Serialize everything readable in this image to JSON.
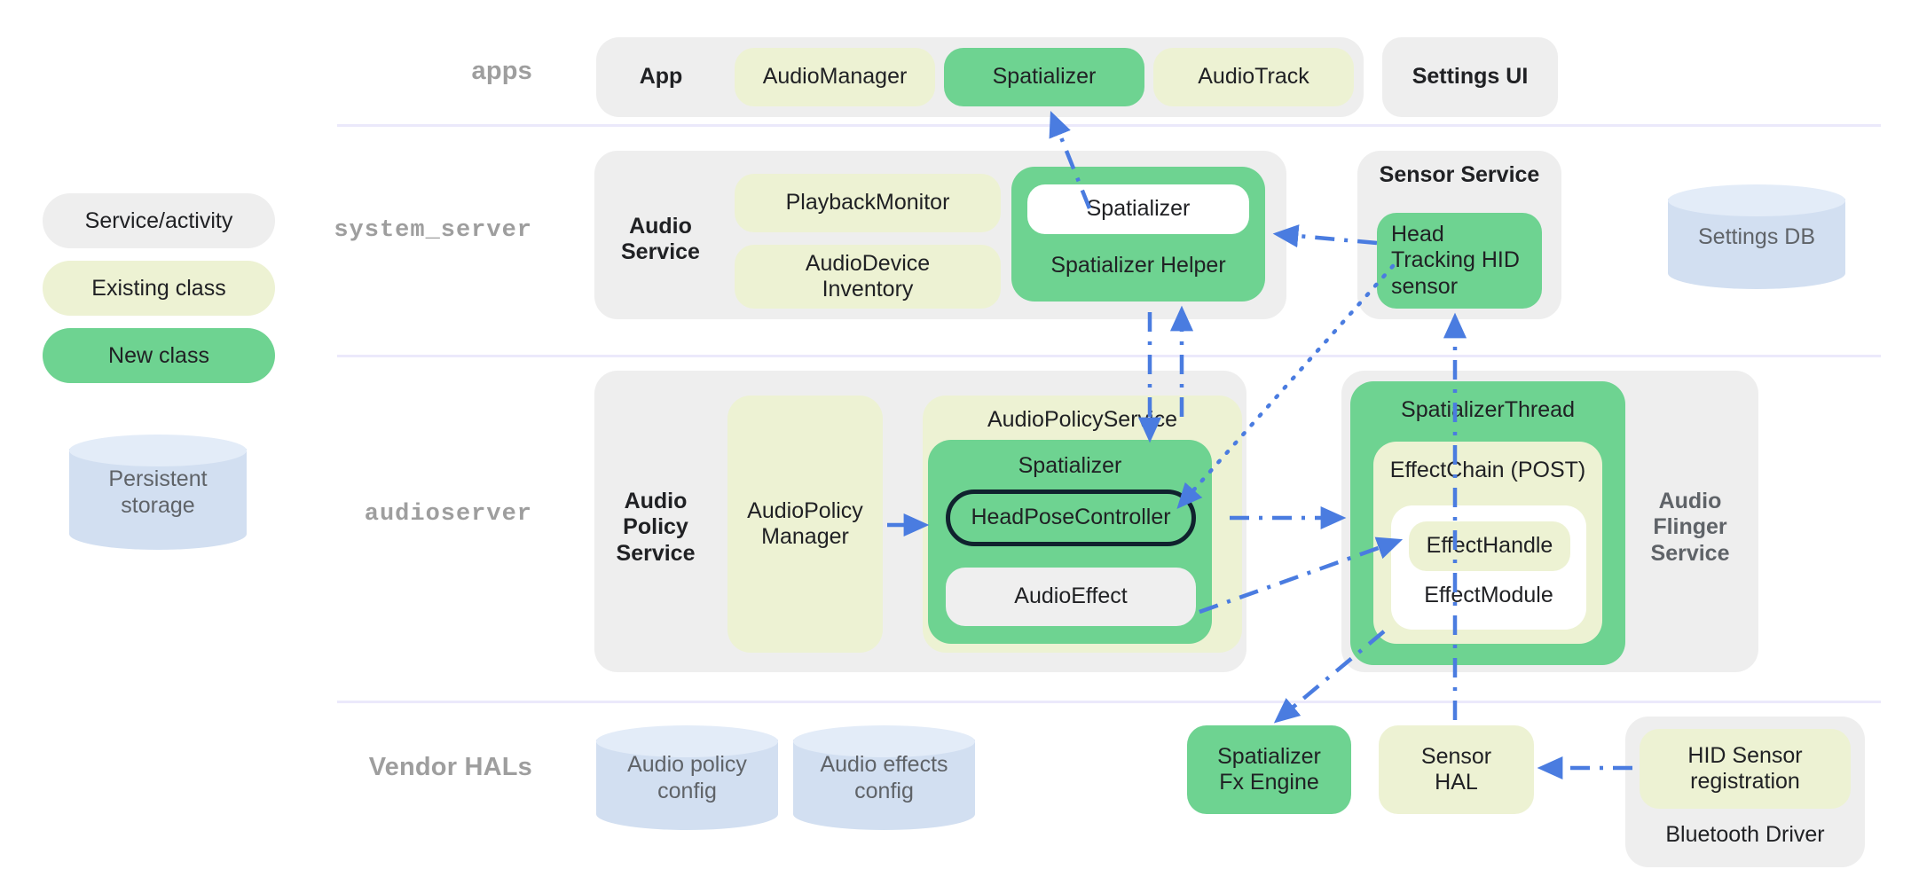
{
  "legend": {
    "items": [
      {
        "label": "Service/activity",
        "kind": "service"
      },
      {
        "label": "Existing class",
        "kind": "existing"
      },
      {
        "label": "New class",
        "kind": "new"
      }
    ],
    "storage_label": "Persistent\nstorage",
    "storage_label_line1": "Persistent",
    "storage_label_line2": "storage",
    "colors": {
      "service": "#eeeeee",
      "existing": "#edf2d3",
      "new": "#6ed391",
      "storage": "#d2dff1",
      "arrow": "#4a7ce0",
      "outline": "#10222e",
      "divider": "#ebe9fb",
      "row_label": "#9e9e9e"
    }
  },
  "rows": [
    {
      "id": "apps",
      "label": "apps"
    },
    {
      "id": "system_server",
      "label": "system_server"
    },
    {
      "id": "audioserver",
      "label": "audioserver"
    },
    {
      "id": "vendor_hals",
      "label": "Vendor HALs"
    }
  ],
  "apps": {
    "app_group_label": "App",
    "nodes": [
      {
        "label": "AudioManager",
        "kind": "existing"
      },
      {
        "label": "Spatializer",
        "kind": "new"
      },
      {
        "label": "AudioTrack",
        "kind": "existing"
      }
    ],
    "settings_ui": "Settings UI"
  },
  "system_server": {
    "audio_service": {
      "title_line1": "Audio",
      "title_line2": "Service",
      "nodes": [
        {
          "label": "PlaybackMonitor",
          "kind": "existing"
        },
        {
          "label_line1": "AudioDevice",
          "label_line2": "Inventory",
          "kind": "existing"
        }
      ],
      "spatializer_group": {
        "inner_label": "Spatializer",
        "helper_label": "Spatializer Helper"
      }
    },
    "sensor_service": {
      "title": "Sensor Service",
      "node_line1": "Head",
      "node_line2": "Tracking HID",
      "node_line3": "sensor"
    },
    "settings_db": "Settings DB"
  },
  "audioserver": {
    "audio_policy_service": {
      "title_line1": "Audio",
      "title_line2": "Policy",
      "title_line3": "Service",
      "audio_policy_manager_line1": "AudioPolicy",
      "audio_policy_manager_line2": "Manager",
      "aps_inner_title": "AudioPolicyService",
      "spatializer_title": "Spatializer",
      "head_pose_controller": "HeadPoseController",
      "audio_effect": "AudioEffect"
    },
    "audio_flinger_service": {
      "title_line1": "Audio",
      "title_line2": "Flinger",
      "title_line3": "Service",
      "spatializer_thread": "SpatializerThread",
      "effect_chain": "EffectChain (POST)",
      "effect_handle": "EffectHandle",
      "effect_module": "EffectModule"
    }
  },
  "vendor_hals": {
    "audio_policy_config_line1": "Audio policy",
    "audio_policy_config_line2": "config",
    "audio_effects_config_line1": "Audio effects",
    "audio_effects_config_line2": "config",
    "spatializer_fx_line1": "Spatializer",
    "spatializer_fx_line2": "Fx Engine",
    "sensor_hal_line1": "Sensor",
    "sensor_hal_line2": "HAL",
    "bluetooth_driver": {
      "hid_line1": "HID Sensor",
      "hid_line2": "registration",
      "title": "Bluetooth Driver"
    }
  }
}
